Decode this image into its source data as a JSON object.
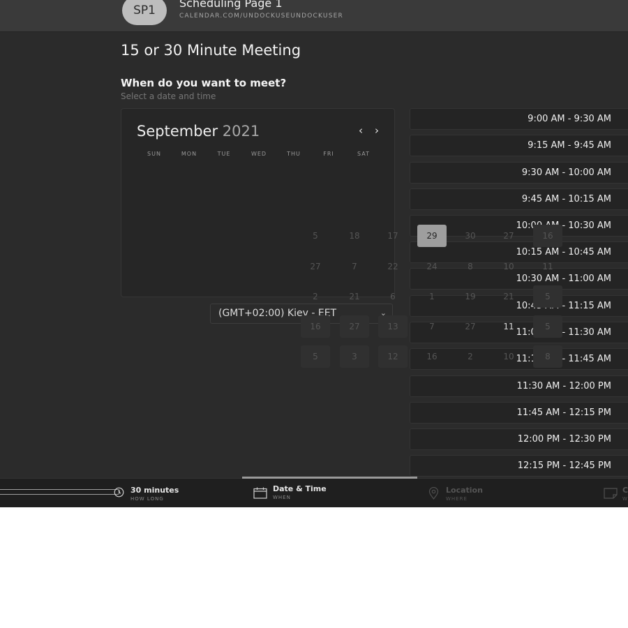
{
  "header": {
    "avatar_initials": "SP1",
    "title": "Scheduling Page 1",
    "url": "CALENDAR.COM/UNDOCKUSEUNDOCKUSER"
  },
  "page": {
    "title": "15 or 30 Minute Meeting",
    "question": "When do you want to meet?",
    "subtitle": "Select a date and time"
  },
  "calendar": {
    "month": "September",
    "year": "2021",
    "prev_icon": "‹",
    "next_icon": "›",
    "weekdays": [
      "SUN",
      "MON",
      "TUE",
      "WED",
      "THU",
      "FRI",
      "SAT"
    ],
    "visible_day_numbers": [
      "5",
      "18",
      "17",
      "29",
      "30",
      "27",
      "16",
      "27",
      "7",
      "22",
      "24",
      "8",
      "10",
      "11",
      "2",
      "21",
      "6",
      "1",
      "19",
      "21",
      "5",
      "16",
      "27",
      "13",
      "7",
      "27",
      "11",
      "5",
      "5",
      "3",
      "12",
      "16",
      "2",
      "10",
      "8"
    ],
    "selected_day": "29"
  },
  "timezone": {
    "value": "(GMT+02:00) Kiev - EET",
    "caret": "⌄"
  },
  "time_slots": [
    "9:00 AM - 9:30 AM",
    "9:15 AM - 9:45 AM",
    "9:30 AM - 10:00 AM",
    "9:45 AM - 10:15 AM",
    "10:00 AM - 10:30 AM",
    "10:15 AM - 10:45 AM",
    "10:30 AM - 11:00 AM",
    "10:45 AM - 11:15 AM",
    "11:00 AM - 11:30 AM",
    "11:15 AM - 11:45 AM",
    "11:30 AM - 12:00 PM",
    "11:45 AM - 12:15 PM",
    "12:00 PM - 12:30 PM",
    "12:15 PM - 12:45 PM"
  ],
  "steps": [
    {
      "label": "30 minutes",
      "sub": "HOW LONG",
      "icon": "clock-icon"
    },
    {
      "label": "Date & Time",
      "sub": "WHEN",
      "icon": "calendar-icon"
    },
    {
      "label": "Location",
      "sub": "WHERE",
      "icon": "location-pin-icon"
    },
    {
      "label": "C",
      "sub": "W",
      "icon": "chat-icon"
    }
  ],
  "colors": {
    "background": "#2b2b2b",
    "header": "#3a3a3a",
    "slot": "#242424",
    "selected_day": "#9e9e9e",
    "bottom_bar": "#1f1f1f"
  }
}
